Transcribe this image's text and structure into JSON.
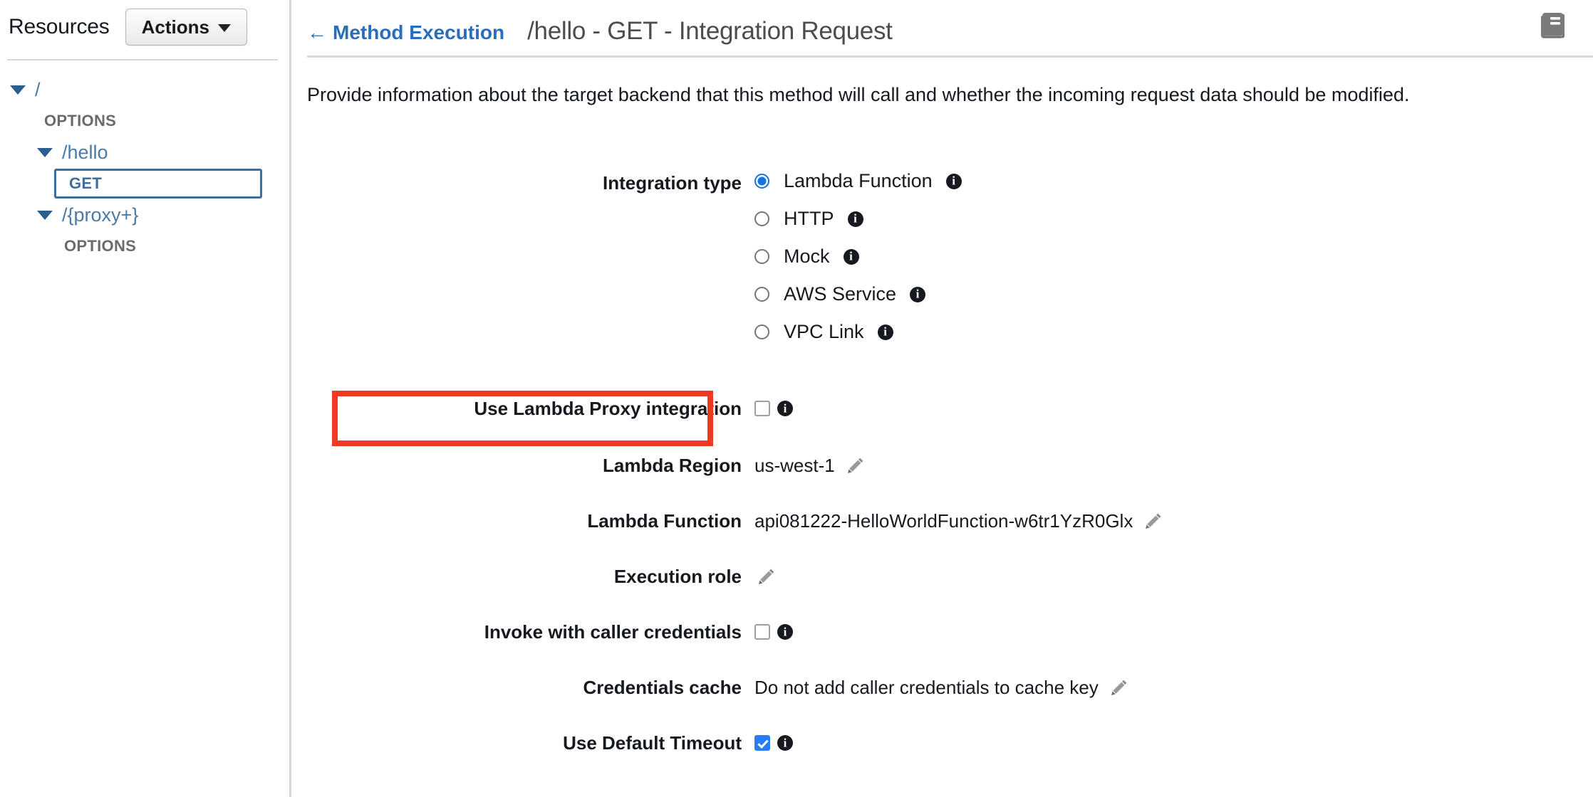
{
  "sidebar": {
    "title": "Resources",
    "actions_button": "Actions",
    "tree": [
      {
        "label": "/",
        "type": "resource",
        "expanded": true,
        "indent": 0
      },
      {
        "label": "OPTIONS",
        "type": "method",
        "indent": 1
      },
      {
        "label": "/hello",
        "type": "resource",
        "expanded": true,
        "indent": 1
      },
      {
        "label": "GET",
        "type": "method",
        "indent": 2,
        "selected": true
      },
      {
        "label": "/{proxy+}",
        "type": "resource",
        "expanded": true,
        "indent": 1
      },
      {
        "label": "OPTIONS",
        "type": "method",
        "indent": 2
      }
    ]
  },
  "header": {
    "back_link": "Method Execution",
    "back_arrow": "←",
    "title": "/hello - GET - Integration Request",
    "docs_icon": "book-icon"
  },
  "main": {
    "description": "Provide information about the target backend that this method will call and whether the incoming request data should be modified."
  },
  "form": {
    "integration_type": {
      "label": "Integration type",
      "selected": "Lambda Function",
      "options": [
        {
          "label": "Lambda Function",
          "checked": true
        },
        {
          "label": "HTTP",
          "checked": false
        },
        {
          "label": "Mock",
          "checked": false
        },
        {
          "label": "AWS Service",
          "checked": false
        },
        {
          "label": "VPC Link",
          "checked": false
        }
      ]
    },
    "lambda_proxy": {
      "label": "Use Lambda Proxy integration",
      "checked": false,
      "highlighted": true
    },
    "lambda_region": {
      "label": "Lambda Region",
      "value": "us-west-1"
    },
    "lambda_function": {
      "label": "Lambda Function",
      "value": "api081222-HelloWorldFunction-w6tr1YzR0Glx"
    },
    "execution_role": {
      "label": "Execution role",
      "value": ""
    },
    "invoke_with_caller_credentials": {
      "label": "Invoke with caller credentials",
      "checked": false
    },
    "credentials_cache": {
      "label": "Credentials cache",
      "value": "Do not add caller credentials to cache key"
    },
    "use_default_timeout": {
      "label": "Use Default Timeout",
      "checked": true
    }
  },
  "colors": {
    "highlight_red": "#ee3a23",
    "link_blue": "#2a6ebb",
    "tree_blue": "#4a7ba8",
    "selected_border": "#3f6e9e",
    "radio_blue": "#1473e6",
    "checkbox_blue": "#2a7bf6"
  },
  "icons": {
    "info": "i",
    "caret": "▼"
  }
}
